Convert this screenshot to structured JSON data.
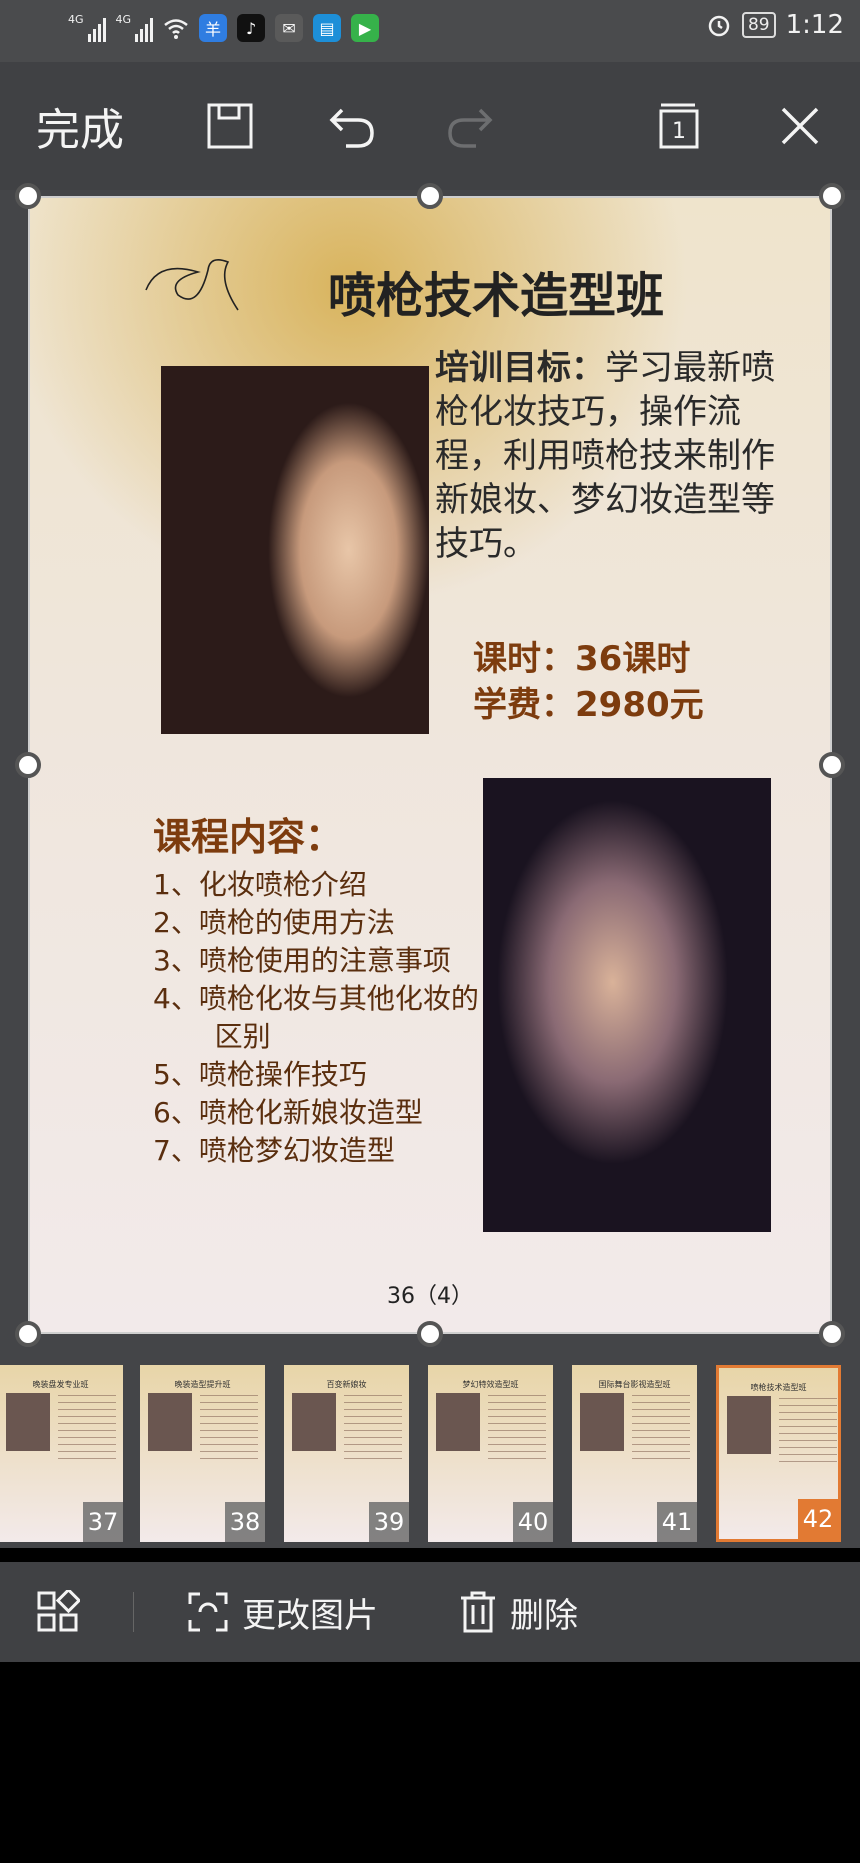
{
  "status_bar": {
    "network_1": "4G",
    "network_2": "4G",
    "battery": "89",
    "time": "1:12",
    "app_icons": [
      "sheep-app-icon",
      "tiktok-icon",
      "wechat-icon",
      "file-app-icon",
      "video-app-icon"
    ]
  },
  "toolbar": {
    "done_label": "完成",
    "page_count": "1"
  },
  "slide": {
    "title": "喷枪技术造型班",
    "goal_label": "培训目标：",
    "goal_text": "学习最新喷枪化妆技巧，操作流程，利用喷枪技来制作新娘妆、梦幻妆造型等技巧。",
    "hours_line": "课时：36课时",
    "fee_line": "学费：2980元",
    "course_heading": "课程内容：",
    "course_items": [
      "1、化妆喷枪介绍",
      "2、喷枪的使用方法",
      "3、喷枪使用的注意事项",
      "4、喷枪化妆与其他化妆的区别",
      "5、喷枪操作技巧",
      "6、喷枪化新娘妆造型",
      "7、喷枪梦幻妆造型"
    ],
    "page_number": "36（4）"
  },
  "thumbnails": [
    {
      "title": "晚装盘发专业班",
      "number": "37"
    },
    {
      "title": "晚装造型提升班",
      "number": "38"
    },
    {
      "title": "百变新娘妆",
      "number": "39"
    },
    {
      "title": "梦幻特效造型班",
      "number": "40"
    },
    {
      "title": "国际舞台影视造型班",
      "number": "41"
    },
    {
      "title": "喷枪技术造型班",
      "number": "42"
    }
  ],
  "bottom_bar": {
    "change_image_label": "更改图片",
    "delete_label": "删除"
  },
  "colors": {
    "accent": "#e27a33",
    "heading_brown": "#7d3c0e"
  }
}
